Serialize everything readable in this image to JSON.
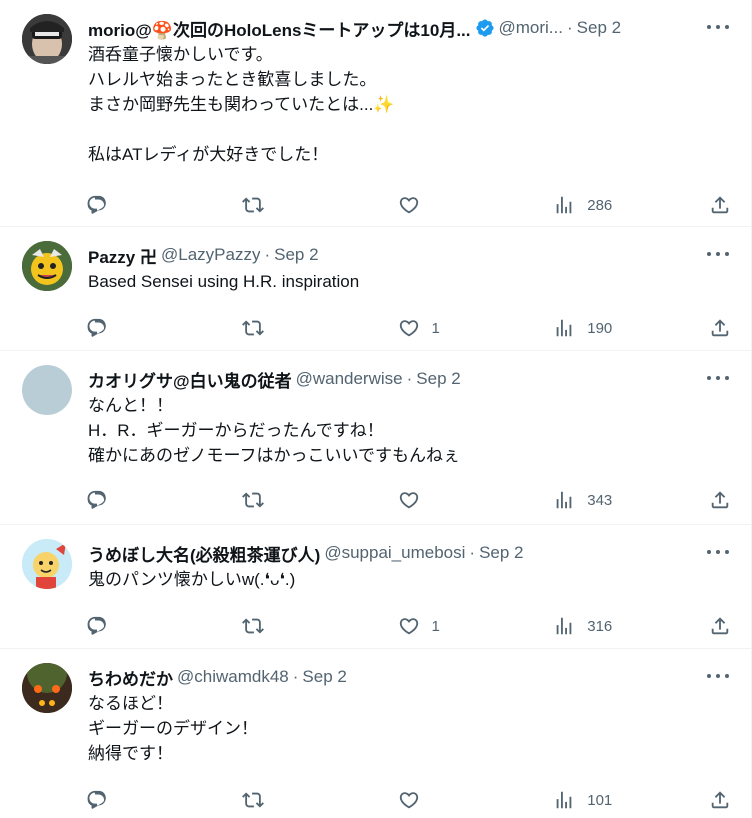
{
  "tweets": [
    {
      "name": "morio@🍄次回のHoloLensミートアップは10月...",
      "handle": "@mori...",
      "dot": "·",
      "time": "Sep 2",
      "verified": true,
      "text": "酒呑童子懐かしいです。\nハレルヤ始まったとき歓喜しました。\nまさか岡野先生も関わっていたとは...✨\n\n私はATレディが大好きでした！",
      "replies": "",
      "retweets": "",
      "likes": "",
      "views": "286"
    },
    {
      "name": "Pazzy 卍",
      "handle": "@LazyPazzy",
      "dot": "·",
      "time": "Sep 2",
      "verified": false,
      "text": "Based Sensei using H.R. inspiration",
      "replies": "",
      "retweets": "",
      "likes": "1",
      "views": "190"
    },
    {
      "name": "カオリグサ@白い鬼の従者",
      "handle": "@wanderwise",
      "dot": "·",
      "time": "Sep 2",
      "verified": false,
      "text": "なんと！！\nH．R．ギーガーからだったんですね！\n確かにあのゼノモーフはかっこいいですもんねぇ",
      "replies": "",
      "retweets": "",
      "likes": "",
      "views": "343"
    },
    {
      "name": "うめぼし大名(必殺粗茶運び人)",
      "handle": "@suppai_umebosi",
      "dot": "·",
      "time": "Sep 2",
      "verified": false,
      "text": "鬼のパンツ懐かしいw(.❛ᴗ❛.)",
      "replies": "",
      "retweets": "",
      "likes": "1",
      "views": "316"
    },
    {
      "name": "ちわめだか",
      "handle": "@chiwamdk48",
      "dot": "·",
      "time": "Sep 2",
      "verified": false,
      "text": "なるほど！\nギーガーのデザイン！\n納得です！",
      "replies": "",
      "retweets": "",
      "likes": "",
      "views": "101"
    }
  ],
  "colors": {
    "text": "#0f1419",
    "secondary": "#536471",
    "verified": "#1d9bf0",
    "divider": "#eff3f4"
  },
  "icons": [
    "reply-icon",
    "retweet-icon",
    "like-icon",
    "views-icon",
    "share-icon",
    "more-icon",
    "verified-icon"
  ]
}
